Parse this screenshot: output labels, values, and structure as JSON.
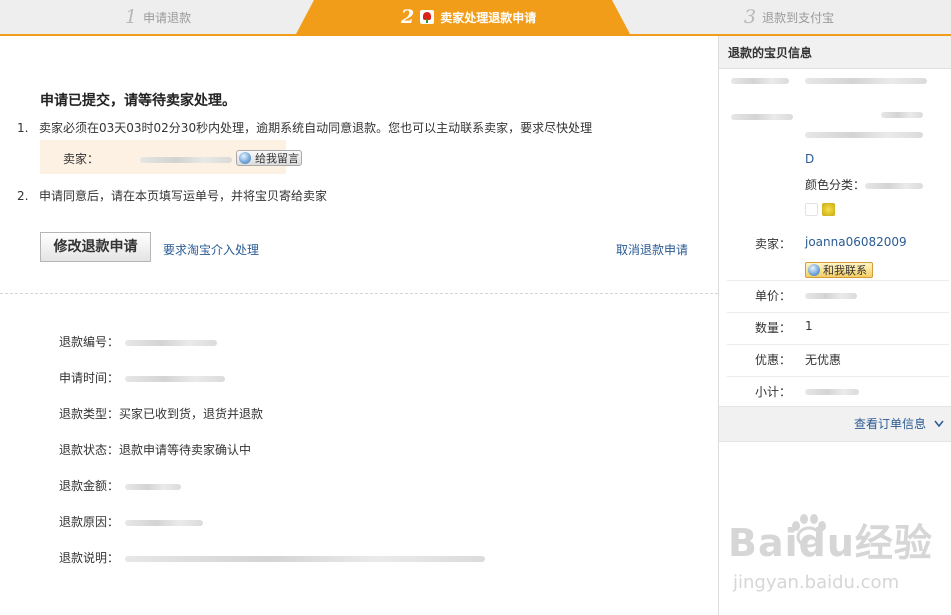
{
  "steps": [
    {
      "num": "1",
      "label": "申请退款"
    },
    {
      "num": "2",
      "label": "卖家处理退款申请"
    },
    {
      "num": "3",
      "label": "退款到支付宝"
    }
  ],
  "colors": {
    "accent": "#f29d19",
    "link": "#2b5b93",
    "seller_box": "#fdf1e3"
  },
  "main": {
    "title": "申请已提交，请等待卖家处理。",
    "items": [
      {
        "num": "1.",
        "text": "卖家必须在03天03时02分30秒内处理，逾期系统自动同意退款。您也可以主动联系卖家，要求尽快处理"
      },
      {
        "num": "2.",
        "text": "申请同意后，请在本页填写运单号，并将宝贝寄给卖家"
      }
    ],
    "seller_label": "卖家：",
    "message_button": "给我留言",
    "modify_button": "修改退款申请",
    "intervene_link": "要求淘宝介入处理",
    "cancel_link": "取消退款申请",
    "details": [
      {
        "label": "退款编号："
      },
      {
        "label": "申请时间："
      },
      {
        "label": "退款类型：",
        "value": "买家已收到货，退货并退款"
      },
      {
        "label": "退款状态：",
        "value": "退款申请等待卖家确认中"
      },
      {
        "label": "退款金额："
      },
      {
        "label": "退款原因："
      },
      {
        "label": "退款说明："
      }
    ]
  },
  "side": {
    "title": "退款的宝贝信息",
    "item_code_tail": "D",
    "color_label": "颜色分类：",
    "seller_label": "卖家：",
    "seller_name": "joanna06082009",
    "contact_button": "和我联系",
    "price_label": "单价：",
    "qty_label": "数量：",
    "qty_value": "1",
    "discount_label": "优惠：",
    "discount_value": "无优惠",
    "subtotal_label": "小计：",
    "view_order_link": "查看订单信息"
  },
  "watermark": {
    "brand": "Baidu经验",
    "url": "jingyan.baidu.com"
  }
}
